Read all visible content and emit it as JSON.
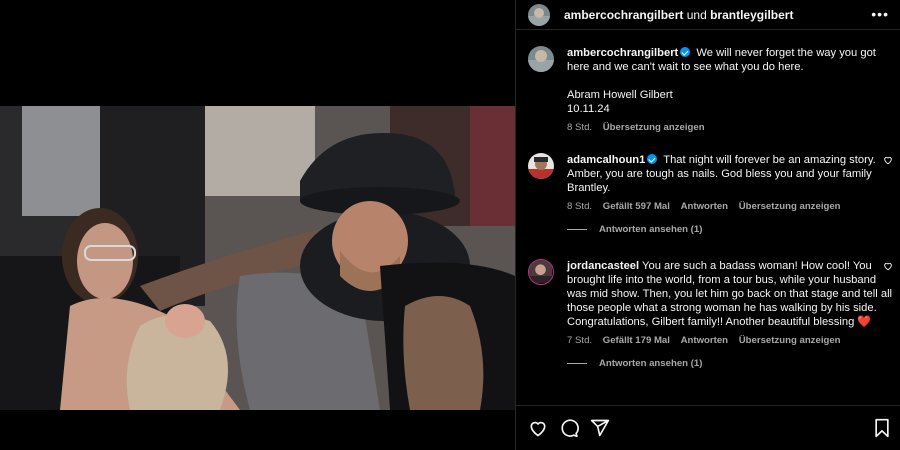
{
  "post": {
    "author": "ambercochrangilbert",
    "connector": "und",
    "coauthor": "brantleygilbert",
    "more_icon": "more-horizontal-icon"
  },
  "caption": {
    "user": "ambercochrangilbert",
    "verified": true,
    "text": "We will never forget the way you got here and we can't wait to see what you do here.",
    "name_line": "Abram Howell Gilbert",
    "date_line": "10.11.24",
    "time": "8 Std.",
    "translate": "Übersetzung anzeigen"
  },
  "comments": [
    {
      "user": "adamcalhoun1",
      "verified": true,
      "text": "That night will forever be an amazing story. Amber, you are tough as nails. God bless you and your family Brantley.",
      "time": "8 Std.",
      "likes": "Gefällt 597 Mal",
      "reply": "Antworten",
      "translate": "Übersetzung anzeigen",
      "view_replies": "Antworten ansehen (1)"
    },
    {
      "user": "jordancasteel",
      "verified": false,
      "text": "You are such a badass woman! How cool! You brought life into the world, from a tour bus, while your husband was mid show. Then, you let him go back on that stage and tell all those people what a strong woman he has walking by his side. Congratulations, Gilbert family!! Another beautiful blessing ❤️",
      "time": "7 Std.",
      "likes": "Gefällt 179 Mal",
      "reply": "Antworten",
      "translate": "Übersetzung anzeigen",
      "view_replies": "Antworten ansehen (1)"
    }
  ],
  "actions": [
    "heart-icon",
    "comment-icon",
    "share-icon",
    "bookmark-icon"
  ],
  "colors": {
    "background": "#000000",
    "text": "#f5f5f5",
    "muted": "#a8a8a8",
    "verified": "#0095f6",
    "divider": "#262626"
  }
}
